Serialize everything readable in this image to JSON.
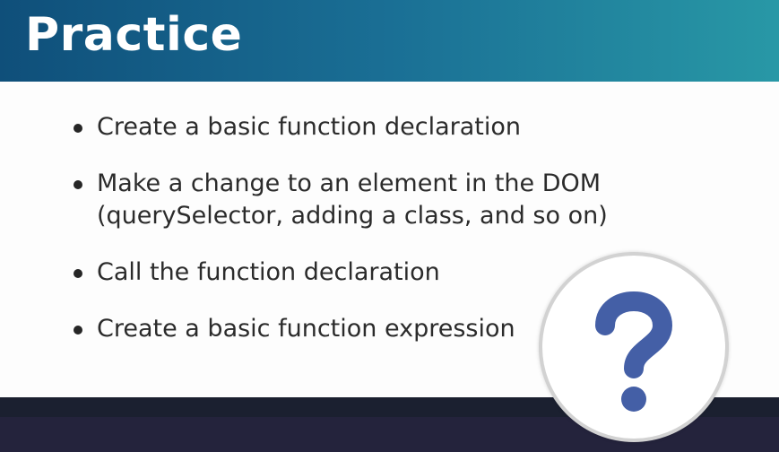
{
  "slide": {
    "title": "Practice",
    "bullets": [
      {
        "line1": "Create a basic function declaration",
        "line2": ""
      },
      {
        "line1": "Make a change to an element in the DOM",
        "line2": "(querySelector, adding a class, and so on)"
      },
      {
        "line1": "Call the function declaration",
        "line2": ""
      },
      {
        "line1": "Create a basic function expression",
        "line2": ""
      }
    ]
  },
  "icon": {
    "name": "question-mark-icon",
    "color": "#445fa6"
  },
  "colors": {
    "header_start": "#0f4f7a",
    "header_end": "#2898a6",
    "text": "#2b2b2b"
  }
}
